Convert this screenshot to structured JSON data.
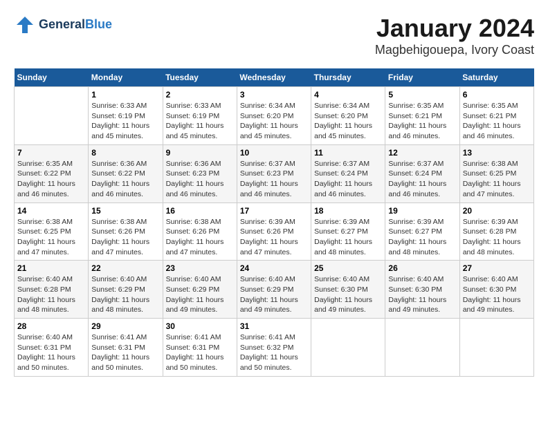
{
  "header": {
    "logo_line1": "General",
    "logo_line2": "Blue",
    "month_title": "January 2024",
    "location": "Magbehigouepa, Ivory Coast"
  },
  "days_of_week": [
    "Sunday",
    "Monday",
    "Tuesday",
    "Wednesday",
    "Thursday",
    "Friday",
    "Saturday"
  ],
  "weeks": [
    [
      {
        "day": "",
        "info": ""
      },
      {
        "day": "1",
        "info": "Sunrise: 6:33 AM\nSunset: 6:19 PM\nDaylight: 11 hours and 45 minutes."
      },
      {
        "day": "2",
        "info": "Sunrise: 6:33 AM\nSunset: 6:19 PM\nDaylight: 11 hours and 45 minutes."
      },
      {
        "day": "3",
        "info": "Sunrise: 6:34 AM\nSunset: 6:20 PM\nDaylight: 11 hours and 45 minutes."
      },
      {
        "day": "4",
        "info": "Sunrise: 6:34 AM\nSunset: 6:20 PM\nDaylight: 11 hours and 45 minutes."
      },
      {
        "day": "5",
        "info": "Sunrise: 6:35 AM\nSunset: 6:21 PM\nDaylight: 11 hours and 46 minutes."
      },
      {
        "day": "6",
        "info": "Sunrise: 6:35 AM\nSunset: 6:21 PM\nDaylight: 11 hours and 46 minutes."
      }
    ],
    [
      {
        "day": "7",
        "info": "Sunrise: 6:35 AM\nSunset: 6:22 PM\nDaylight: 11 hours and 46 minutes."
      },
      {
        "day": "8",
        "info": "Sunrise: 6:36 AM\nSunset: 6:22 PM\nDaylight: 11 hours and 46 minutes."
      },
      {
        "day": "9",
        "info": "Sunrise: 6:36 AM\nSunset: 6:23 PM\nDaylight: 11 hours and 46 minutes."
      },
      {
        "day": "10",
        "info": "Sunrise: 6:37 AM\nSunset: 6:23 PM\nDaylight: 11 hours and 46 minutes."
      },
      {
        "day": "11",
        "info": "Sunrise: 6:37 AM\nSunset: 6:24 PM\nDaylight: 11 hours and 46 minutes."
      },
      {
        "day": "12",
        "info": "Sunrise: 6:37 AM\nSunset: 6:24 PM\nDaylight: 11 hours and 46 minutes."
      },
      {
        "day": "13",
        "info": "Sunrise: 6:38 AM\nSunset: 6:25 PM\nDaylight: 11 hours and 47 minutes."
      }
    ],
    [
      {
        "day": "14",
        "info": "Sunrise: 6:38 AM\nSunset: 6:25 PM\nDaylight: 11 hours and 47 minutes."
      },
      {
        "day": "15",
        "info": "Sunrise: 6:38 AM\nSunset: 6:26 PM\nDaylight: 11 hours and 47 minutes."
      },
      {
        "day": "16",
        "info": "Sunrise: 6:38 AM\nSunset: 6:26 PM\nDaylight: 11 hours and 47 minutes."
      },
      {
        "day": "17",
        "info": "Sunrise: 6:39 AM\nSunset: 6:26 PM\nDaylight: 11 hours and 47 minutes."
      },
      {
        "day": "18",
        "info": "Sunrise: 6:39 AM\nSunset: 6:27 PM\nDaylight: 11 hours and 48 minutes."
      },
      {
        "day": "19",
        "info": "Sunrise: 6:39 AM\nSunset: 6:27 PM\nDaylight: 11 hours and 48 minutes."
      },
      {
        "day": "20",
        "info": "Sunrise: 6:39 AM\nSunset: 6:28 PM\nDaylight: 11 hours and 48 minutes."
      }
    ],
    [
      {
        "day": "21",
        "info": "Sunrise: 6:40 AM\nSunset: 6:28 PM\nDaylight: 11 hours and 48 minutes."
      },
      {
        "day": "22",
        "info": "Sunrise: 6:40 AM\nSunset: 6:29 PM\nDaylight: 11 hours and 48 minutes."
      },
      {
        "day": "23",
        "info": "Sunrise: 6:40 AM\nSunset: 6:29 PM\nDaylight: 11 hours and 49 minutes."
      },
      {
        "day": "24",
        "info": "Sunrise: 6:40 AM\nSunset: 6:29 PM\nDaylight: 11 hours and 49 minutes."
      },
      {
        "day": "25",
        "info": "Sunrise: 6:40 AM\nSunset: 6:30 PM\nDaylight: 11 hours and 49 minutes."
      },
      {
        "day": "26",
        "info": "Sunrise: 6:40 AM\nSunset: 6:30 PM\nDaylight: 11 hours and 49 minutes."
      },
      {
        "day": "27",
        "info": "Sunrise: 6:40 AM\nSunset: 6:30 PM\nDaylight: 11 hours and 49 minutes."
      }
    ],
    [
      {
        "day": "28",
        "info": "Sunrise: 6:40 AM\nSunset: 6:31 PM\nDaylight: 11 hours and 50 minutes."
      },
      {
        "day": "29",
        "info": "Sunrise: 6:41 AM\nSunset: 6:31 PM\nDaylight: 11 hours and 50 minutes."
      },
      {
        "day": "30",
        "info": "Sunrise: 6:41 AM\nSunset: 6:31 PM\nDaylight: 11 hours and 50 minutes."
      },
      {
        "day": "31",
        "info": "Sunrise: 6:41 AM\nSunset: 6:32 PM\nDaylight: 11 hours and 50 minutes."
      },
      {
        "day": "",
        "info": ""
      },
      {
        "day": "",
        "info": ""
      },
      {
        "day": "",
        "info": ""
      }
    ]
  ]
}
